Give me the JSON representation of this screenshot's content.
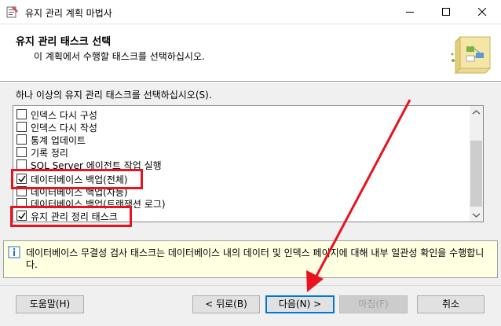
{
  "window": {
    "title": "유지 관리 계획 마법사"
  },
  "header": {
    "title": "유지 관리 태스크 선택",
    "subtitle": "이 계획에서 수행할 태스크를 선택하십시오."
  },
  "instruction": "하나 이상의 유지 관리 태스크를 선택하십시오(S).",
  "tasks": [
    {
      "label": "인덱스 다시 구성",
      "checked": false
    },
    {
      "label": "인덱스 다시 작성",
      "checked": false
    },
    {
      "label": "통계 업데이트",
      "checked": false
    },
    {
      "label": "기록 정리",
      "checked": false
    },
    {
      "label": "SQL Server 에이전트 작업 실행",
      "checked": false
    },
    {
      "label": "데이터베이스 백업(전체)",
      "checked": true
    },
    {
      "label": "데이터베이스 백업(차등)",
      "checked": false
    },
    {
      "label": "데이터베이스 백업(트랜잭션 로그)",
      "checked": false
    },
    {
      "label": "유지 관리 정리 태스크",
      "checked": true
    }
  ],
  "description": "데이터베이스 무결성 검사 태스크는 데이터베이스 내의 데이터 및 인덱스 페이지에 대해 내부 일관성 확인을 수행합니다.",
  "buttons": {
    "help": "도움말(H)",
    "back": "< 뒤로(B)",
    "next": "다음(N) >",
    "finish": "마침(F)",
    "cancel": "취소"
  },
  "colors": {
    "highlight": "#e8131f",
    "focus": "#0078d7",
    "info_bg": "#ffffe1"
  },
  "icons": [
    "app-icon",
    "minimize-icon",
    "maximize-icon",
    "close-icon",
    "wizard-graphic",
    "info-icon",
    "checkmark-icon",
    "scroll-up-icon",
    "scroll-down-icon"
  ]
}
